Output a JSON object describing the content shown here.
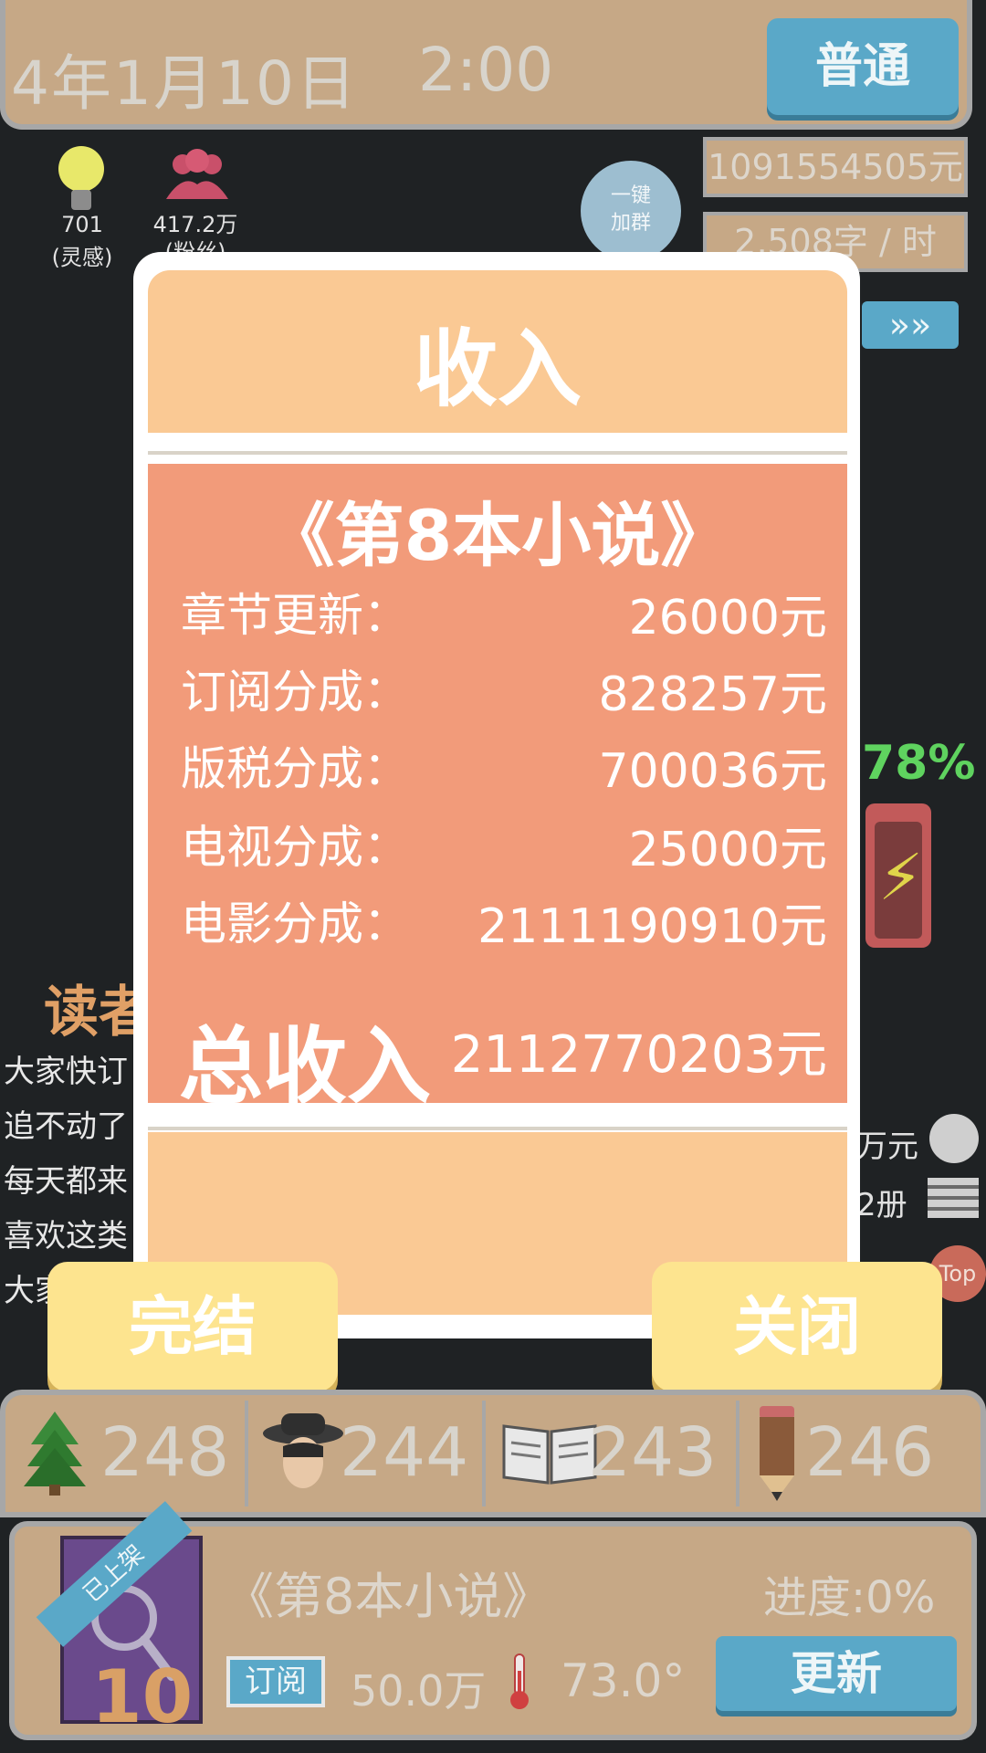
{
  "top_bar": {
    "date": "4年1月10日",
    "time": "2:00",
    "speed_label": "普通"
  },
  "stats": {
    "inspiration_value": "701",
    "inspiration_label": "(灵感)",
    "fans_value": "417.2万",
    "fans_label": "(粉丝)",
    "group_button": [
      "一键",
      "加群"
    ],
    "money": "1091554505元",
    "writing_speed": "2,508字 / 时",
    "arrow_label": "»»"
  },
  "background": {
    "percent": "78%",
    "reader_title": "读者",
    "comments": [
      "大家快订",
      "追不动了",
      "每天都来",
      "喜欢这类",
      "大家"
    ],
    "right_values": [
      "万元",
      "2册"
    ],
    "top_button": "Top"
  },
  "dialog": {
    "title": "收入",
    "novel_name": "《第8本小说》",
    "rows": [
      {
        "label": "章节更新：",
        "value": "26000元"
      },
      {
        "label": "订阅分成：",
        "value": "828257元"
      },
      {
        "label": "版税分成：",
        "value": "700036元"
      },
      {
        "label": "电视分成：",
        "value": "25000元"
      },
      {
        "label": "电影分成：",
        "value": "2111190910元"
      }
    ],
    "total_label": "总收入",
    "total_value": "2112770203元",
    "finish_button": "完结",
    "close_button": "关闭"
  },
  "attributes": [
    {
      "icon": "tree-icon",
      "value": "248"
    },
    {
      "icon": "detective-icon",
      "value": "244"
    },
    {
      "icon": "book-icon",
      "value": "243"
    },
    {
      "icon": "pencil-icon",
      "value": "246"
    }
  ],
  "book_panel": {
    "ribbon": "已上架",
    "count": "10",
    "title": "《第8本小说》",
    "progress": "进度:0%",
    "subscribe_label": "订阅",
    "subscribe_count": "50.0万",
    "heat": "73.0°",
    "update_button": "更新"
  },
  "colors": {
    "panel": "#c6a886",
    "dialog_header": "#fac994",
    "dialog_body": "#f29b7a",
    "button_blue": "#5aa8c8",
    "button_yellow": "#fde48f"
  }
}
